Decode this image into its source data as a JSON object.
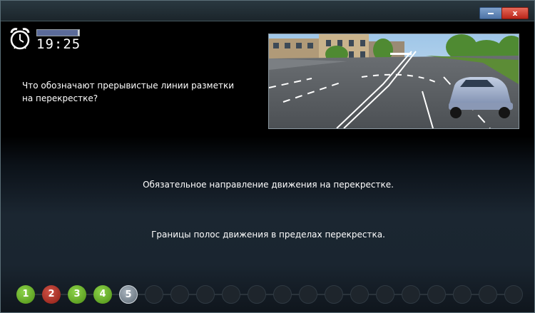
{
  "window": {
    "close_label": "x"
  },
  "timer": {
    "display": "19:25",
    "progress_fraction": 0.97
  },
  "question": {
    "text": "Что обозначают прерывистые линии разметки на перекрестке?"
  },
  "answers": [
    "Обязательное направление движения на перекрестке.",
    "Границы полос движения в пределах перекрестка."
  ],
  "question_nav": {
    "items": [
      {
        "label": "1",
        "state": "correct"
      },
      {
        "label": "2",
        "state": "wrong"
      },
      {
        "label": "3",
        "state": "correct"
      },
      {
        "label": "4",
        "state": "correct"
      },
      {
        "label": "5",
        "state": "current"
      },
      {
        "label": "",
        "state": "empty"
      },
      {
        "label": "",
        "state": "empty"
      },
      {
        "label": "",
        "state": "empty"
      },
      {
        "label": "",
        "state": "empty"
      },
      {
        "label": "",
        "state": "empty"
      },
      {
        "label": "",
        "state": "empty"
      },
      {
        "label": "",
        "state": "empty"
      },
      {
        "label": "",
        "state": "empty"
      },
      {
        "label": "",
        "state": "empty"
      },
      {
        "label": "",
        "state": "empty"
      },
      {
        "label": "",
        "state": "empty"
      },
      {
        "label": "",
        "state": "empty"
      },
      {
        "label": "",
        "state": "empty"
      },
      {
        "label": "",
        "state": "empty"
      },
      {
        "label": "",
        "state": "empty"
      }
    ]
  },
  "colors": {
    "correct": "#6cb22a",
    "wrong": "#b5352a",
    "current": "#7d8893",
    "empty": "#1e252c"
  }
}
